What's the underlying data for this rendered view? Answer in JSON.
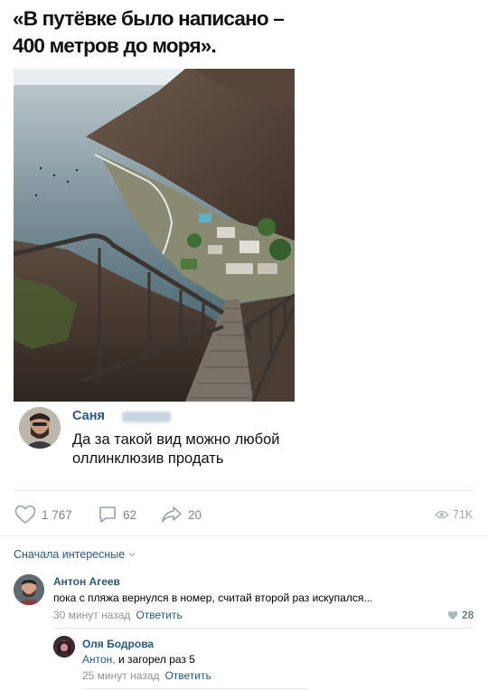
{
  "post": {
    "title": "«В путёвке было написано – 400 метров до моря».",
    "comment_card": {
      "author": "Саня",
      "text": "Да за такой вид можно любой оллинклюзив продать"
    }
  },
  "stats": {
    "likes": "1 767",
    "comments": "62",
    "shares": "20",
    "views": "71K"
  },
  "comments_section": {
    "sort_label": "Сначала интересные",
    "comments": [
      {
        "author": "Антон Агеев",
        "text": "пока с пляжа вернулся в номер, считай второй раз искупался...",
        "time": "30 минут назад",
        "reply_label": "Ответить",
        "likes": "28"
      },
      {
        "author": "Оля Бодрова",
        "reply_to": "Антон,",
        "text": " и загорел раз 5",
        "time": "25 минут назад",
        "reply_label": "Ответить"
      }
    ]
  },
  "colors": {
    "link": "#2a5885",
    "meta": "#939393",
    "divider": "#e7e8ec",
    "icon": "#828282"
  }
}
